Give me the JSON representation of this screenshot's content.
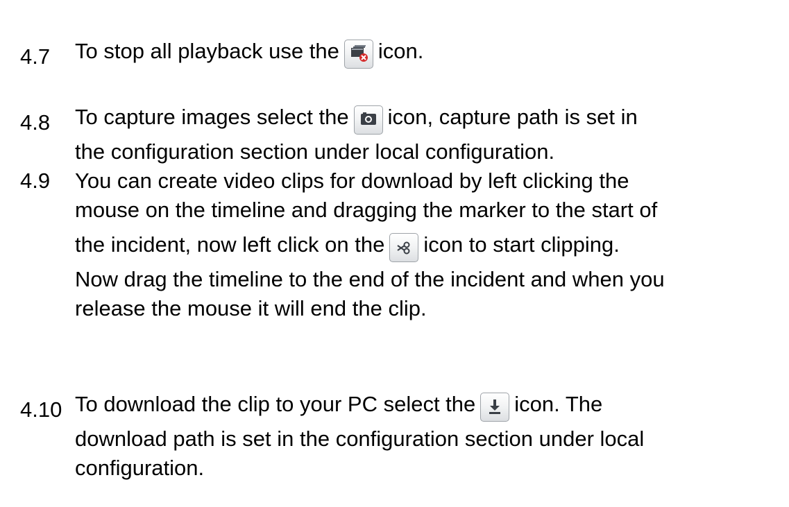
{
  "sections": [
    {
      "number": "4.7",
      "lines": [
        {
          "before": "To stop all playback use the",
          "icon": "stop-all-playback-icon",
          "after": "icon."
        }
      ]
    },
    {
      "number": "4.8",
      "lines": [
        {
          "before": "To capture images select the",
          "icon": "camera-capture-icon",
          "after": "icon, capture path is set in"
        },
        {
          "text": "the configuration section under local configuration."
        }
      ]
    },
    {
      "number": "4.9",
      "lines": [
        {
          "text": "You can create video clips for download by left clicking the"
        },
        {
          "text": "mouse on the timeline and dragging the marker to the start of"
        },
        {
          "before": "the incident, now left click on the",
          "icon": "scissors-clip-icon",
          "after": "icon to start clipping."
        },
        {
          "text": "Now drag the timeline to the end of the incident and when you"
        },
        {
          "text": "release the mouse it will end the clip."
        }
      ]
    },
    {
      "number": "4.10",
      "lines": [
        {
          "before": "To download the clip to your PC select the",
          "icon": "download-icon",
          "after": "icon. The"
        },
        {
          "text": "download path is set in the configuration section under local"
        },
        {
          "text": "configuration."
        }
      ]
    }
  ]
}
